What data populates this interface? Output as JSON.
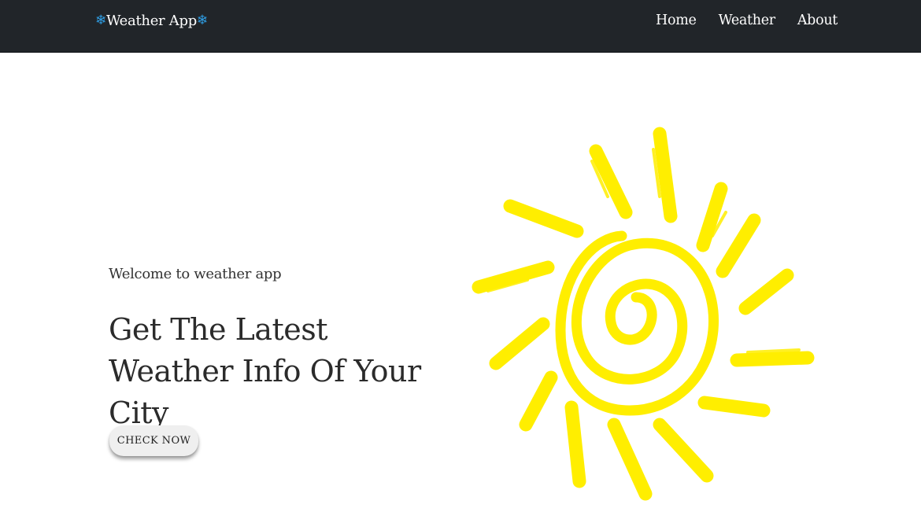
{
  "navbar": {
    "brand_icon_left": "❄",
    "brand_text": "Weather App",
    "brand_icon_right": "❄",
    "links": [
      {
        "label": "Home"
      },
      {
        "label": "Weather"
      },
      {
        "label": "About"
      }
    ],
    "background_color": "#212529",
    "snow_icon_color": "#2f9fe6"
  },
  "hero": {
    "welcome": "Welcome to weather app",
    "headline": "Get The Latest Weather Info Of Your City",
    "cta_label": "CHECK NOW",
    "illustration": "sun-icon",
    "sun_color": "#ffee00"
  }
}
